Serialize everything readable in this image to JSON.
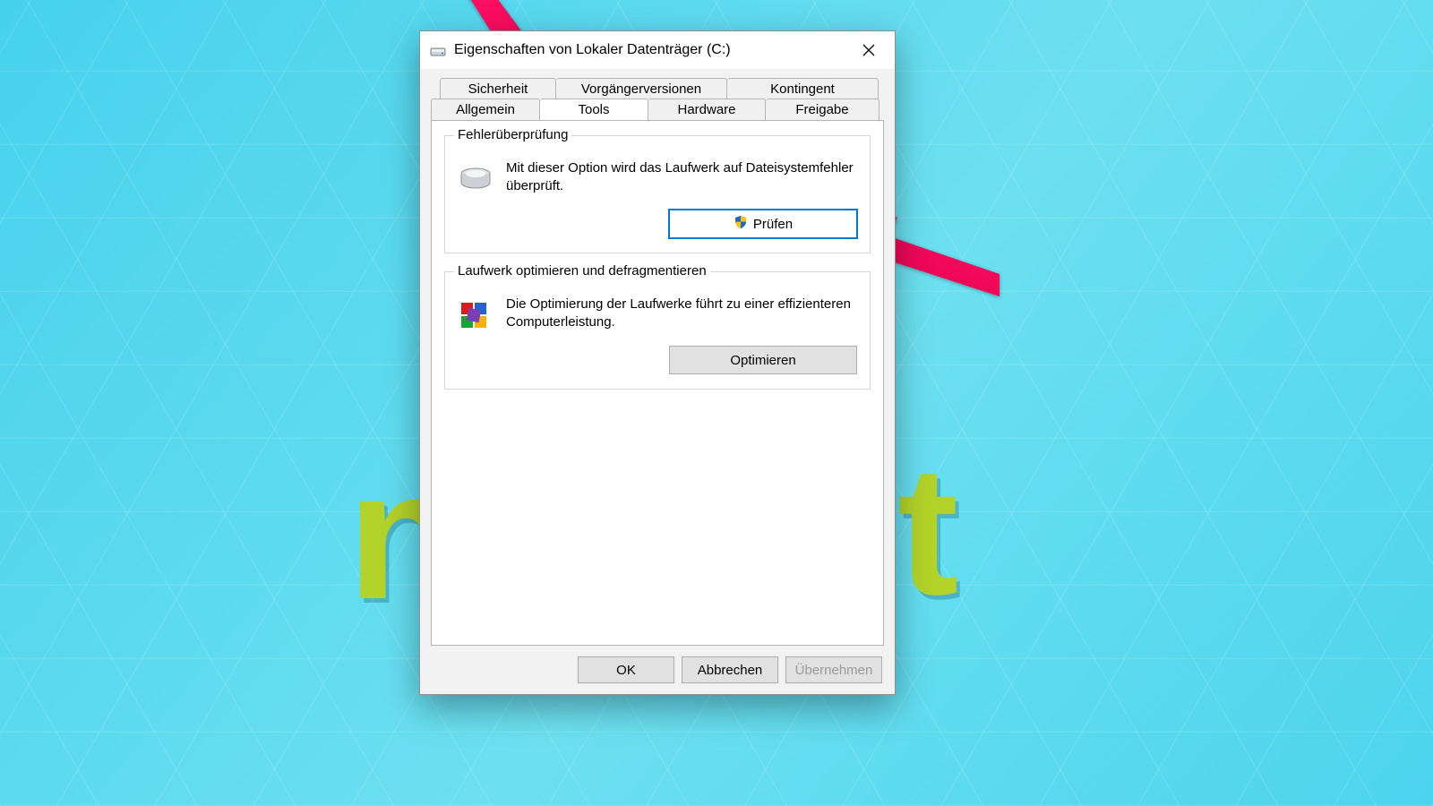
{
  "window": {
    "title": "Eigenschaften von Lokaler Datenträger (C:)"
  },
  "tabs": {
    "row1": [
      "Sicherheit",
      "Vorgängerversionen",
      "Kontingent"
    ],
    "row2": [
      "Allgemein",
      "Tools",
      "Hardware",
      "Freigabe"
    ],
    "active": "Tools"
  },
  "group_error_check": {
    "legend": "Fehlerüberprüfung",
    "description": "Mit dieser Option wird das Laufwerk auf Dateisystemfehler überprüft.",
    "button": "Prüfen"
  },
  "group_optimize": {
    "legend": "Laufwerk optimieren und defragmentieren",
    "description": "Die Optimierung der Laufwerke führt zu einer effizienteren Computerleistung.",
    "button": "Optimieren"
  },
  "footer": {
    "ok": "OK",
    "cancel": "Abbrechen",
    "apply": "Übernehmen"
  },
  "background_letters": {
    "left": "n",
    "right": "t"
  }
}
